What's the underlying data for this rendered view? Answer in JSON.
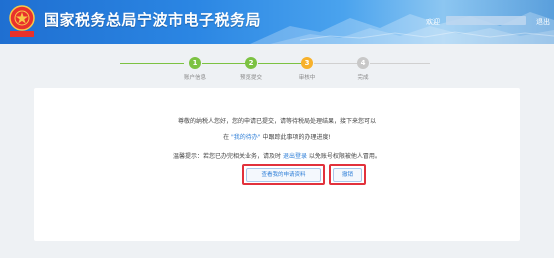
{
  "header": {
    "site_title": "国家税务总局宁波市电子税务局",
    "emblem_text": "中国税务",
    "welcome_label": "欢迎",
    "logout_label": "退出"
  },
  "steps": [
    {
      "number": "1",
      "label": "账户信息",
      "state": "done"
    },
    {
      "number": "2",
      "label": "预览提交",
      "state": "done"
    },
    {
      "number": "3",
      "label": "审核中",
      "state": "current"
    },
    {
      "number": "4",
      "label": "完成",
      "state": "pending"
    }
  ],
  "colors": {
    "done": "#7cc242",
    "current": "#f7b12b",
    "pending": "#c8c8c8",
    "highlight": "#e2313c",
    "link": "#2f7fd8"
  },
  "message": {
    "line1": "尊敬的纳税人您好，您的申请已提交，请等待税局处理结果，接下来您可以",
    "line2_prefix": "在",
    "line2_link": "\"我的待办\"",
    "line2_suffix": "中跟踪此事项的办理进度!",
    "line3_prefix": "温馨提示：若您已办完相关业务，请及时",
    "line3_link": "退出登录",
    "line3_suffix": "以免账号权限被他人冒用。"
  },
  "buttons": {
    "view_materials": "查看我的申请资料",
    "withdraw": "撤销"
  }
}
